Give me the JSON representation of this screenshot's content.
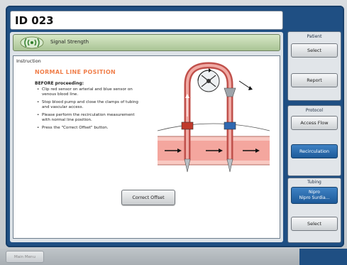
{
  "header": {
    "id_label": "ID 023"
  },
  "signal": {
    "label": "Signal Strength"
  },
  "instruction": {
    "panel_title": "Instruction",
    "heading": "NORMAL LINE POSITION",
    "before": "BEFORE proceeding:",
    "bullets": [
      "Clip red sensor on arterial and blue sensor on venous blood line.",
      "Stop blood pump and close the clamps of tubing and vascular access.",
      "Please perform the recirculation measurement with normal line position.",
      "Press the \"Correct Offset\" button."
    ],
    "correct_offset": "Correct Offset"
  },
  "side": {
    "patient": {
      "title": "Patient",
      "select": "Select",
      "report": "Report"
    },
    "protocol": {
      "title": "Protocol",
      "access_flow": "Access Flow",
      "recirculation": "Recirculation"
    },
    "tubing": {
      "title": "Tubing",
      "line1": "Nipro",
      "line2": "Nipro Surdia...",
      "select": "Select"
    }
  },
  "footer": {
    "main_menu": "Main Menu"
  },
  "colors": {
    "frame_blue": "#1f4f83",
    "accent_orange": "#f07f4b",
    "signal_green": "#aac495",
    "active_blue": "#2a6bb0"
  }
}
